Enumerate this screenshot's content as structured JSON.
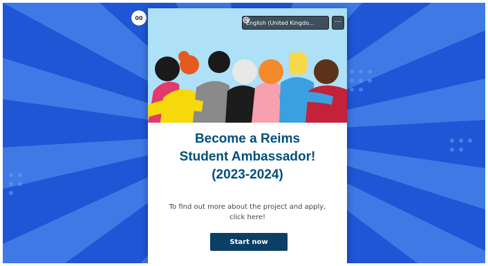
{
  "avatar": {
    "initials": "00"
  },
  "language_selector": {
    "label": "English (United Kingdo...",
    "icon": "globe-icon",
    "dropdown_icon": "chevron-down-icon"
  },
  "more_options": {
    "label": "···"
  },
  "form": {
    "title_line1": "Become a Reims",
    "title_line2": "Student Ambassador!",
    "title_line3": "(2023-2024)",
    "subtitle_line1": "To find out more about the project and apply,",
    "subtitle_line2": "click here!",
    "start_label": "Start now"
  },
  "colors": {
    "background_blue": "#1f56d6",
    "ray_light": "#4a86ee",
    "title_color": "#004e7c",
    "button_bg": "#0b3f66",
    "hero_sky": "#aee0f7"
  }
}
